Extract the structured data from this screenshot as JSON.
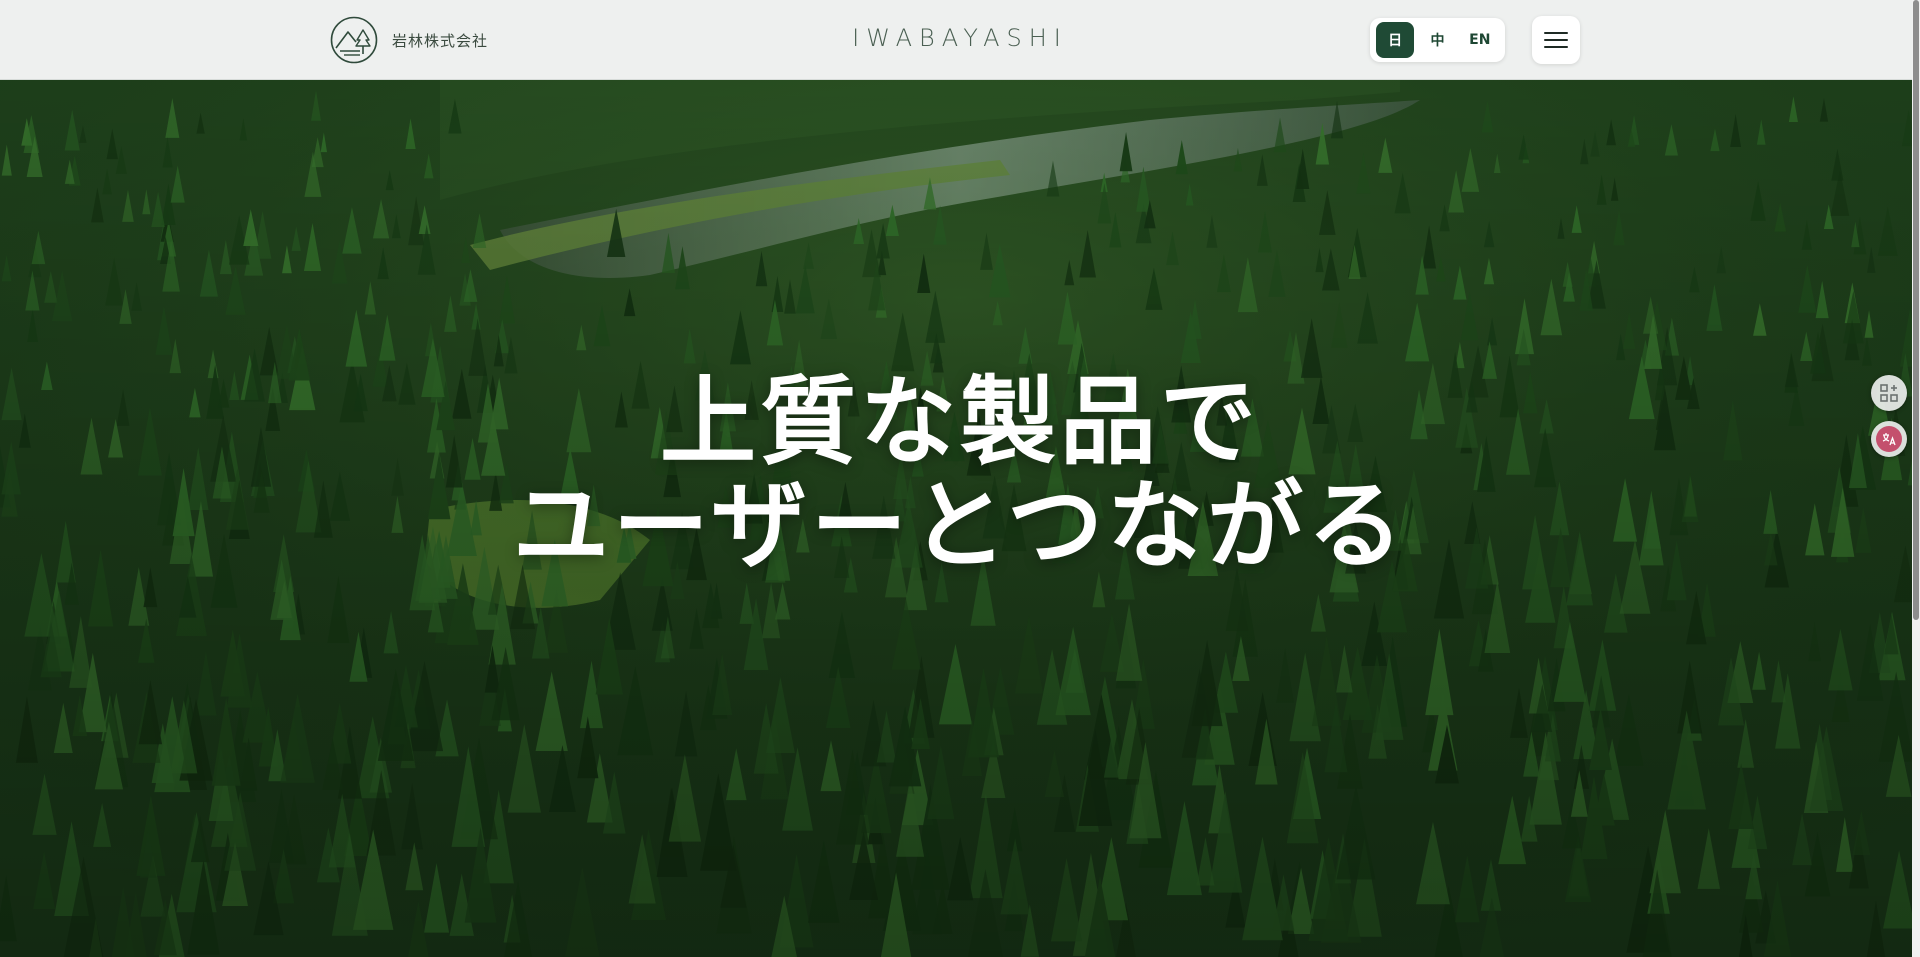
{
  "header": {
    "logo_text": "岩林株式会社",
    "brand": "IWABAYASHI",
    "languages": [
      {
        "label": "日",
        "active": true
      },
      {
        "label": "中",
        "active": false
      },
      {
        "label": "EN",
        "active": false
      }
    ],
    "menu_icon": "hamburger-menu-icon"
  },
  "hero": {
    "headline_line1": "上質な製品で",
    "headline_line2": "ユーザーとつながる",
    "background": "aerial-forest-lake-photo"
  },
  "side_widgets": [
    {
      "icon": "apps-add-icon"
    },
    {
      "icon": "translate-icon"
    }
  ],
  "colors": {
    "accent": "#1f4a35",
    "header_bg": "#eef0ef",
    "forest_dark": "#122c10",
    "translate_badge": "#c4506d"
  }
}
